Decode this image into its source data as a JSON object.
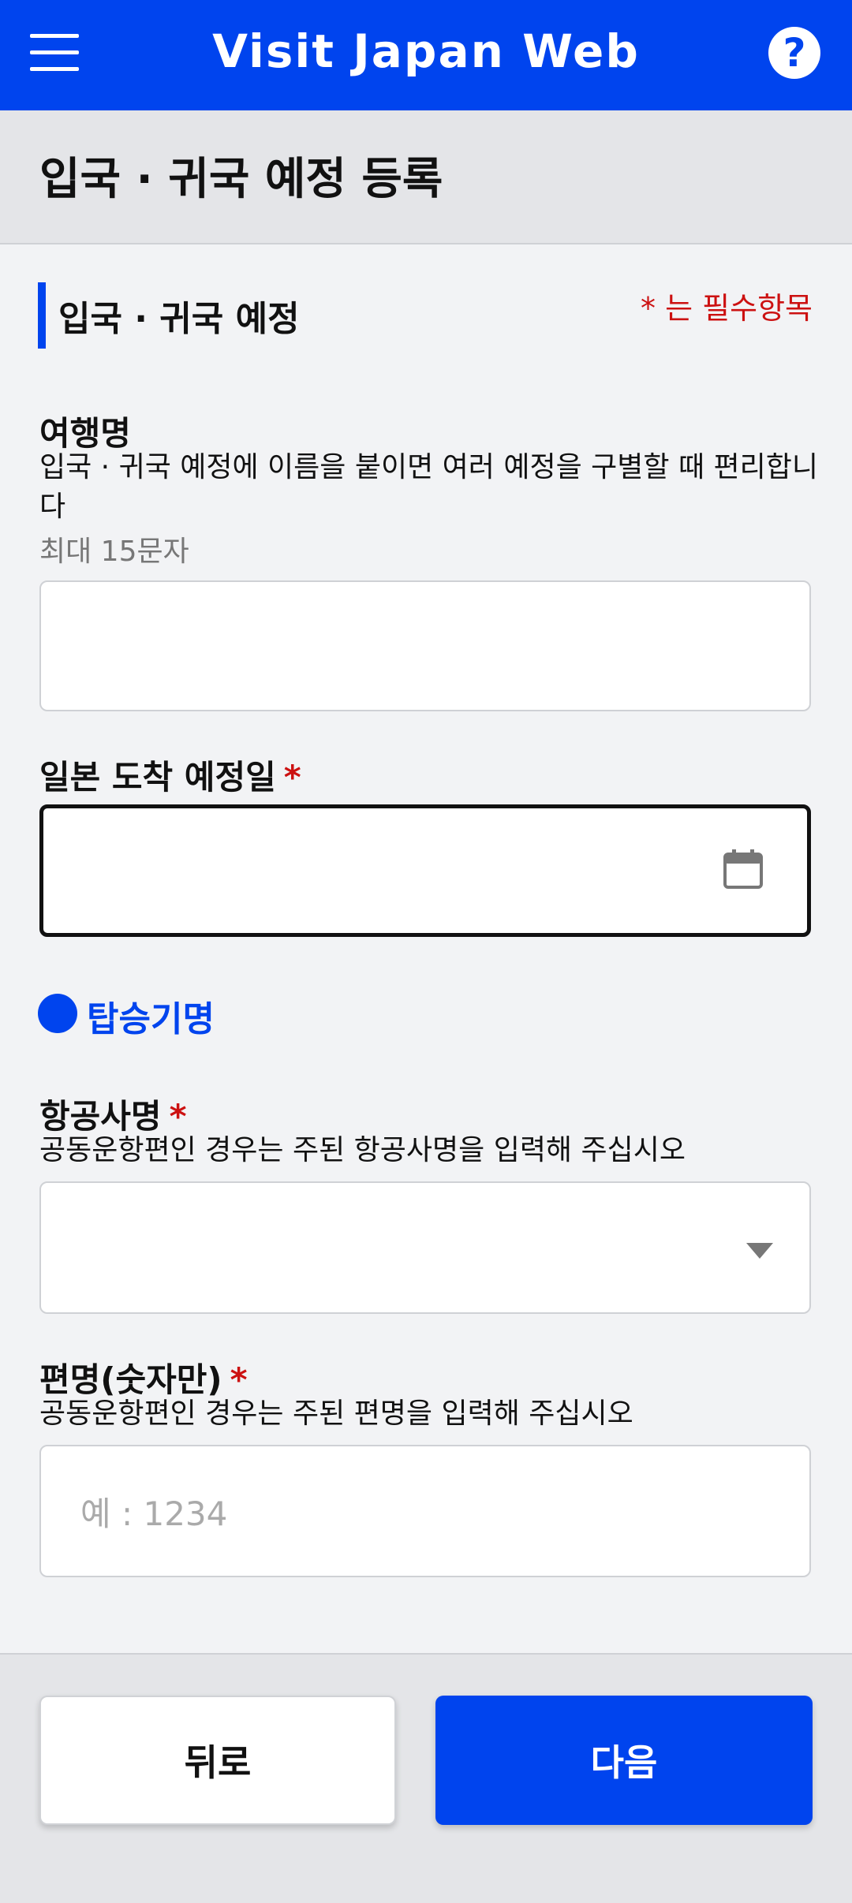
{
  "colors": {
    "brand": "#0044ee",
    "required": "#cc1111"
  },
  "app": {
    "title": "Visit Japan Web",
    "menu_icon": "hamburger-menu-icon",
    "help_label": "?"
  },
  "page": {
    "title": "입국 · 귀국 예정 등록"
  },
  "section": {
    "title": "입국 · 귀국 예정",
    "required_note": "* 는 필수항목"
  },
  "trip_name": {
    "label": "여행명",
    "description": "입국 · 귀국 예정에 이름을 붙이면 여러 예정을 구별할 때 편리합니다",
    "hint": "최대 15문자",
    "value": ""
  },
  "arrival_date": {
    "label": "일본 도착 예정일",
    "required_mark": "*",
    "value": "",
    "icon": "calendar-icon"
  },
  "flight": {
    "title": "탑승기명",
    "airline": {
      "label": "항공사명",
      "required_mark": "*",
      "description": "공동운항편인 경우는 주된 항공사명을 입력해 주십시오",
      "value": ""
    },
    "number": {
      "label": "편명(숫자만)",
      "required_mark": "*",
      "description": "공동운항편인 경우는 주된 편명을 입력해 주십시오",
      "placeholder": "예 : 1234"
    }
  },
  "footer": {
    "back_label": "뒤로",
    "next_label": "다음"
  }
}
